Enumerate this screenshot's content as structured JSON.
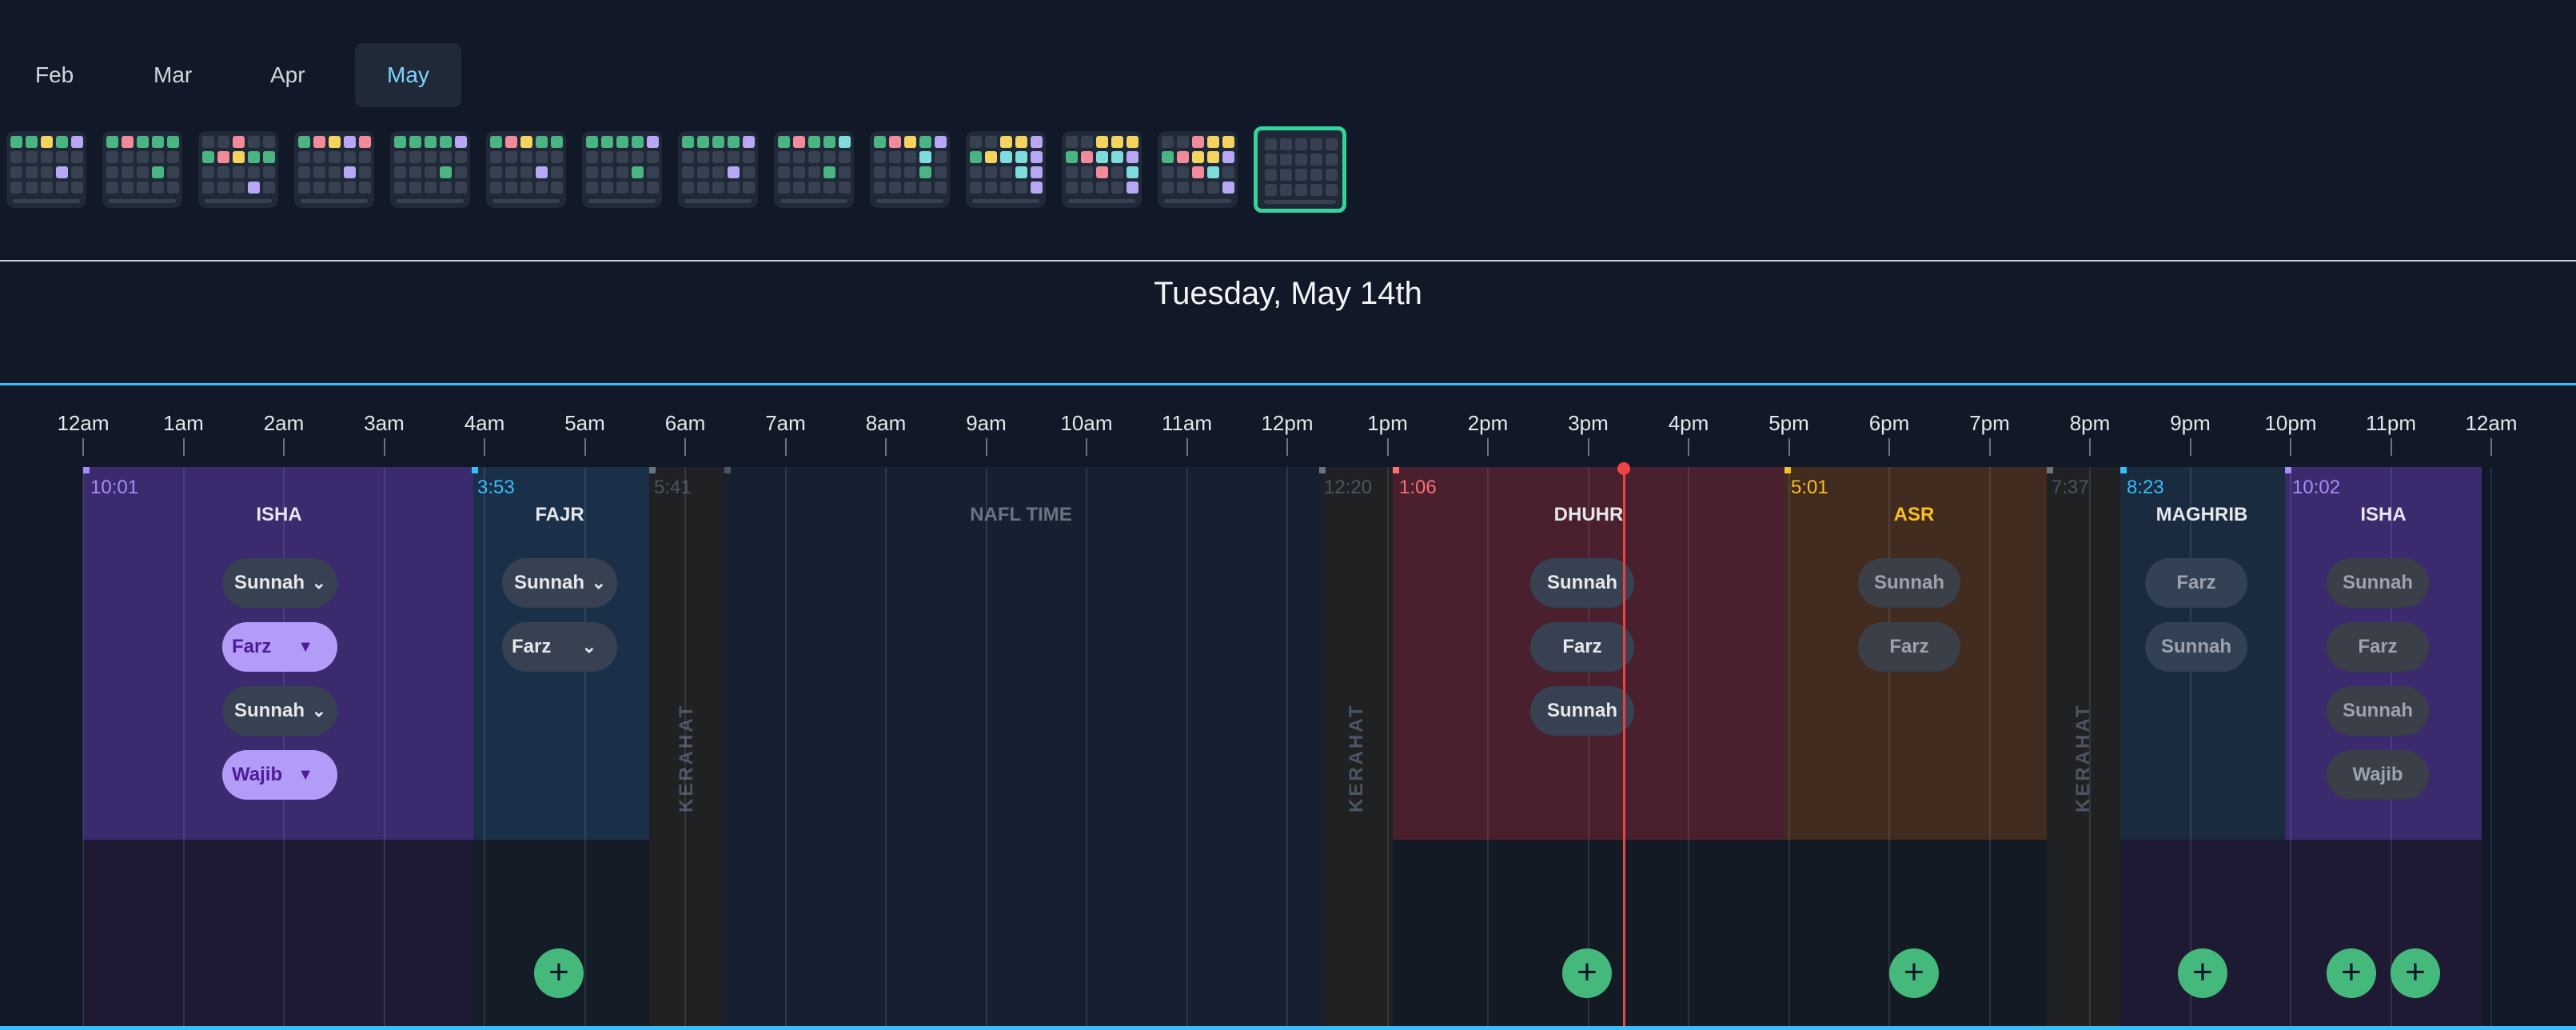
{
  "months": [
    {
      "label": "Feb",
      "active": false
    },
    {
      "label": "Mar",
      "active": false
    },
    {
      "label": "Apr",
      "active": false
    },
    {
      "label": "May",
      "active": true
    }
  ],
  "colors": {
    "green": "#4ab583",
    "pink": "#f38a9a",
    "yellow": "#f4d35e",
    "cyan": "#7fdcdc",
    "lavender": "#b7a7f5",
    "empty": "#374151",
    "accent": "#38bdf8",
    "now": "#ef4444"
  },
  "week_thumbnails": [
    {
      "rows": [
        "ggygl",
        ".e..",
        "...l"
      ]
    },
    {
      "rows": [
        "gpggg",
        ".e..",
        "...g"
      ]
    },
    {
      "rows": [
        "..p..",
        "gpygg",
        ".e..",
        "...l"
      ]
    },
    {
      "rows": [
        "gpylp",
        ".e..",
        "...l"
      ]
    },
    {
      "rows": [
        "ggggl",
        ".e..",
        "...g"
      ]
    },
    {
      "rows": [
        "gpygg",
        ".e..",
        "...l"
      ]
    },
    {
      "rows": [
        "ggggl",
        ".e..",
        "...g"
      ]
    },
    {
      "rows": [
        "ggggl",
        ".e..",
        "...l"
      ]
    },
    {
      "rows": [
        "gpggc",
        ".e..",
        "...g"
      ]
    },
    {
      "rows": [
        "gpygl",
        "...c.",
        "...g"
      ]
    },
    {
      "rows": [
        "..yyl",
        "gyccl",
        "...cl",
        "....l"
      ]
    },
    {
      "rows": [
        "..yyy",
        "gpccl",
        "..p.c",
        "....l"
      ]
    },
    {
      "rows": [
        "..pyy",
        "gpyyl",
        "..pc.",
        "....l"
      ]
    },
    {
      "rows": [
        "....",
        "....",
        "....",
        "...."
      ],
      "active": true
    }
  ],
  "date_title": "Tuesday, May 14th",
  "hour_labels": [
    "12am",
    "1am",
    "2am",
    "3am",
    "4am",
    "5am",
    "6am",
    "7am",
    "8am",
    "9am",
    "10am",
    "11am",
    "12pm",
    "1pm",
    "2pm",
    "3pm",
    "4pm",
    "5pm",
    "6pm",
    "7pm",
    "8pm",
    "9pm",
    "10pm",
    "11pm",
    "12am"
  ],
  "blocks": [
    {
      "name": "ISHA",
      "start": "10:01",
      "type": "prayer",
      "color": "#a78bfa"
    },
    {
      "name": "FAJR",
      "start": "3:53",
      "type": "prayer",
      "color": "#38bdf8"
    },
    {
      "name": "KERAHAT",
      "start": "5:41",
      "type": "kerahat"
    },
    {
      "name": "NAFL TIME",
      "start": "",
      "type": "nafl"
    },
    {
      "name": "KERAHAT",
      "start": "12:20",
      "type": "kerahat"
    },
    {
      "name": "DHUHR",
      "start": "1:06",
      "type": "prayer",
      "color": "#f87171"
    },
    {
      "name": "ASR",
      "start": "5:01",
      "type": "prayer",
      "color": "#fbbf24"
    },
    {
      "name": "KERAHAT",
      "start": "7:37",
      "type": "kerahat"
    },
    {
      "name": "MAGHRIB",
      "start": "8:23",
      "type": "prayer",
      "color": "#38bdf8"
    },
    {
      "name": "ISHA",
      "start": "10:02",
      "type": "prayer",
      "color": "#a78bfa"
    }
  ],
  "prayer_buttons": {
    "isha_night": [
      {
        "label": "Sunnah",
        "style": "dark",
        "dropdown": "chevron"
      },
      {
        "label": "Farz",
        "style": "purple",
        "dropdown": "caret"
      },
      {
        "label": "Sunnah",
        "style": "dark",
        "dropdown": "chevron"
      },
      {
        "label": "Wajib",
        "style": "purple",
        "dropdown": "caret"
      }
    ],
    "fajr": [
      {
        "label": "Sunnah",
        "style": "dark",
        "dropdown": "chevron"
      },
      {
        "label": "Farz",
        "style": "dark",
        "dropdown": "chevron"
      }
    ],
    "dhuhr": [
      {
        "label": "Sunnah"
      },
      {
        "label": "Farz"
      },
      {
        "label": "Sunnah"
      }
    ],
    "asr": [
      {
        "label": "Sunnah"
      },
      {
        "label": "Farz"
      }
    ],
    "maghrib": [
      {
        "label": "Farz"
      },
      {
        "label": "Sunnah"
      }
    ],
    "isha_evening": [
      {
        "label": "Sunnah"
      },
      {
        "label": "Farz"
      },
      {
        "label": "Sunnah"
      },
      {
        "label": "Wajib"
      }
    ]
  },
  "add_button_label": "+"
}
